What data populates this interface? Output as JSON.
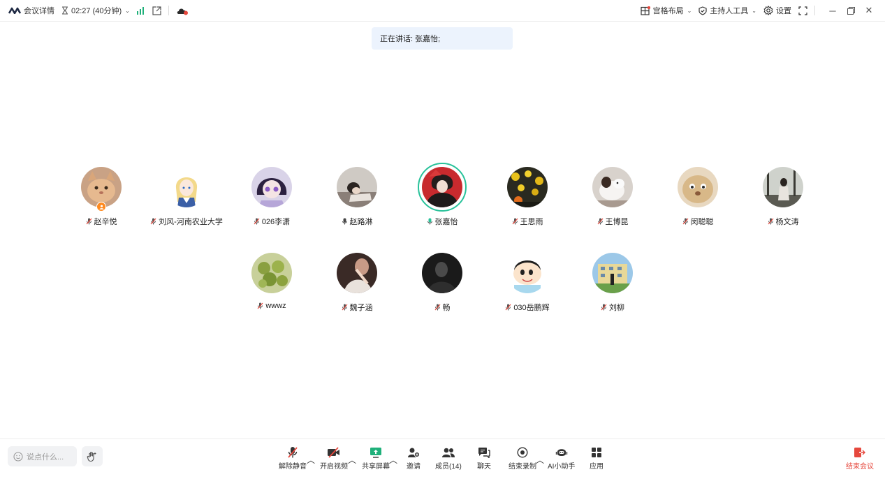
{
  "topbar": {
    "meeting_details": "会议详情",
    "timer": "02:27 (40分钟)",
    "grid_layout": "宫格布局",
    "host_tools": "主持人工具",
    "settings": "设置"
  },
  "speaking_banner": "正在讲话: 张嘉怡;",
  "participants": [
    {
      "name": "赵辛悦",
      "mic": "muted",
      "host": true
    },
    {
      "name": "刘风-河南农业大学",
      "mic": "muted"
    },
    {
      "name": "026李潇",
      "mic": "muted"
    },
    {
      "name": "赵路淋",
      "mic": "on"
    },
    {
      "name": "张嘉怡",
      "mic": "speaking",
      "active": true
    },
    {
      "name": "王思雨",
      "mic": "muted"
    },
    {
      "name": "王博昆",
      "mic": "muted"
    },
    {
      "name": "闵聪聪",
      "mic": "muted"
    },
    {
      "name": "杨文涛",
      "mic": "muted"
    },
    {
      "name": "wwwz",
      "mic": "muted"
    },
    {
      "name": "魏子涵",
      "mic": "muted"
    },
    {
      "name": "畅",
      "mic": "muted"
    },
    {
      "name": "030岳鹏辉",
      "mic": "muted"
    },
    {
      "name": "刘柳",
      "mic": "muted"
    }
  ],
  "bottombar": {
    "chat_placeholder": "说点什么...",
    "unmute": "解除静音",
    "start_video": "开启视频",
    "share_screen": "共享屏幕",
    "invite": "邀请",
    "members": "成员(14)",
    "chat": "聊天",
    "end_recording": "结束录制",
    "ai_assistant": "AI小助手",
    "apps": "应用",
    "end_meeting": "结束会议"
  },
  "colors": {
    "accent_green": "#29c29a",
    "end_red": "#e6483d",
    "banner_bg": "#ecf3fd",
    "signal_green": "#1fb07a"
  }
}
